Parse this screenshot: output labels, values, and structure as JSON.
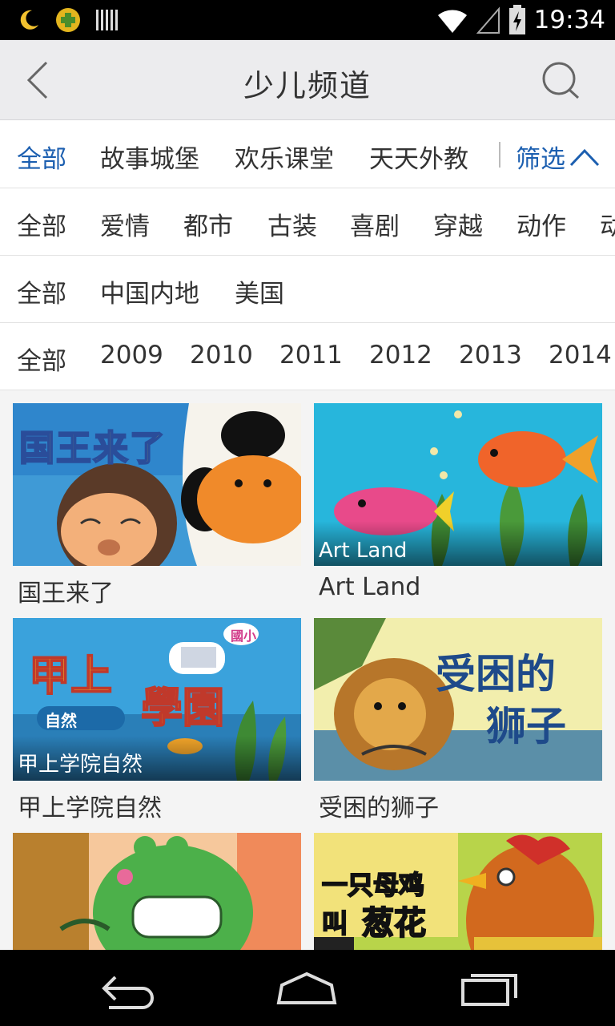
{
  "status_bar": {
    "time": "19:34",
    "icons": [
      "moon-icon",
      "app-cross-icon",
      "barcode-icon",
      "wifi-icon",
      "signal-icon",
      "battery-charging-icon"
    ]
  },
  "header": {
    "title": "少儿频道",
    "back_icon": "chevron-left-icon",
    "search_icon": "search-icon"
  },
  "tabs": {
    "items": [
      "全部",
      "故事城堡",
      "欢乐课堂",
      "天天外教"
    ],
    "active_index": 0,
    "filter_label": "筛选",
    "filter_icon": "chevron-up-icon",
    "active_color": "#1c5fb0"
  },
  "filters": {
    "genre": [
      "全部",
      "爱情",
      "都市",
      "古装",
      "喜剧",
      "穿越",
      "动作",
      "动"
    ],
    "region": [
      "全部",
      "中国内地",
      "美国"
    ],
    "year": [
      "全部",
      "2009",
      "2010",
      "2011",
      "2012",
      "2013",
      "2014"
    ]
  },
  "grid": {
    "items": [
      {
        "title": "国王来了",
        "overlay": ""
      },
      {
        "title": "Art Land",
        "overlay": "Art Land"
      },
      {
        "title": "甲上学院自然",
        "overlay": "甲上学院自然"
      },
      {
        "title": "受困的狮子",
        "overlay": ""
      },
      {
        "title": "",
        "overlay": ""
      },
      {
        "title": "",
        "overlay": ""
      }
    ],
    "thumb_text": {
      "t1": "国王来了",
      "t3a": "甲上",
      "t3b": "學園",
      "t3c": "自然",
      "t3d": "國小",
      "t4a": "受困的",
      "t4b": "狮子",
      "t6a": "一只母鸡",
      "t6b": "叫",
      "t6c": "葱花"
    }
  },
  "nav_bar": {
    "icons": [
      "back-arrow-icon",
      "home-icon",
      "recent-apps-icon"
    ]
  }
}
